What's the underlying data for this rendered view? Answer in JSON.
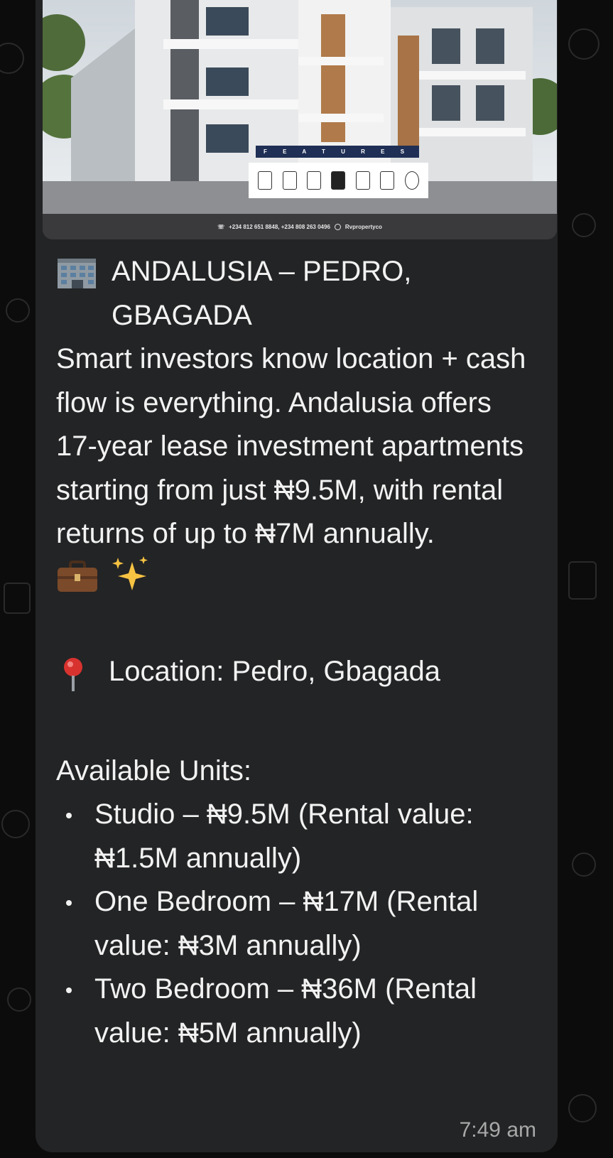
{
  "image": {
    "banner_label": "F E A T U R E S",
    "contact_text": "+234 812 651 8848, +234 808 263 0496",
    "handle_text": "Rvpropertyco",
    "feature_icons": [
      "apartment-icon",
      "security-icon",
      "power-icon",
      "kitchen-icon",
      "lounge-icon",
      "smart-home-icon",
      "gym-icon"
    ]
  },
  "message": {
    "heading_emoji": "building-icon",
    "heading": "ANDALUSIA – PEDRO, GBAGADA",
    "body": "Smart investors know location + cash flow is everything. Andalusia offers 17-year lease investment apartments starting from just ₦9.5M, with rental returns of up to ₦7M annually.",
    "body_emojis": [
      "briefcase-icon",
      "sparkles-icon"
    ],
    "location_emoji": "pin-icon",
    "location": "Location: Pedro, Gbagada",
    "units_heading": "Available Units:",
    "units": [
      "Studio – ₦9.5M (Rental value: ₦1.5M annually)",
      "One Bedroom – ₦17M (Rental value: ₦3M annually)",
      "Two Bedroom – ₦36M (Rental value: ₦5M annually)"
    ],
    "time": "7:49 am"
  }
}
